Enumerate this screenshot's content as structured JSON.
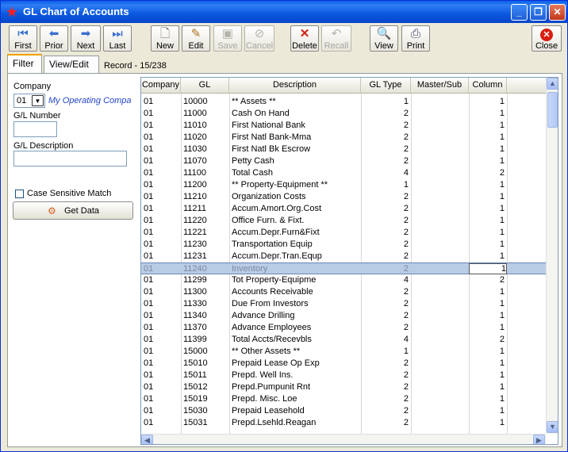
{
  "window": {
    "title": "GL Chart of Accounts"
  },
  "toolbar": {
    "first": "First",
    "prior": "Prior",
    "next": "Next",
    "last": "Last",
    "new": "New",
    "edit": "Edit",
    "save": "Save",
    "cancel": "Cancel",
    "delete": "Delete",
    "recall": "Recall",
    "view": "View",
    "print": "Print",
    "close": "Close"
  },
  "tabs": {
    "filter": "Filter",
    "view_edit": "View/Edit"
  },
  "record": "Record - 15/238",
  "filter": {
    "company_label": "Company",
    "company_value": "01",
    "company_name": "My Operating Compa",
    "gl_number_label": "G/L Number",
    "gl_number_value": "",
    "gl_desc_label": "G/L Description",
    "gl_desc_value": "",
    "case_sensitive_label": "Case Sensitive Match",
    "get_data_label": "Get Data"
  },
  "grid": {
    "columns": [
      "Company",
      "GL",
      "Description",
      "GL Type",
      "Master/Sub",
      "Column"
    ],
    "rows": [
      [
        "01",
        "10000",
        "** Assets **",
        "1",
        "",
        "1"
      ],
      [
        "01",
        "11000",
        "Cash On Hand",
        "2",
        "",
        "1"
      ],
      [
        "01",
        "11010",
        "First National Bank",
        "2",
        "",
        "1"
      ],
      [
        "01",
        "11020",
        "First Natl Bank-Mma",
        "2",
        "",
        "1"
      ],
      [
        "01",
        "11030",
        "First Natl Bk Escrow",
        "2",
        "",
        "1"
      ],
      [
        "01",
        "11070",
        "Petty Cash",
        "2",
        "",
        "1"
      ],
      [
        "01",
        "11100",
        "Total Cash",
        "4",
        "",
        "2"
      ],
      [
        "01",
        "11200",
        "** Property-Equipment **",
        "1",
        "",
        "1"
      ],
      [
        "01",
        "11210",
        "Organization Costs",
        "2",
        "",
        "1"
      ],
      [
        "01",
        "11211",
        "Accum.Amort.Org.Cost",
        "2",
        "",
        "1"
      ],
      [
        "01",
        "11220",
        "Office Furn. & Fixt.",
        "2",
        "",
        "1"
      ],
      [
        "01",
        "11221",
        "Accum.Depr.Furn&Fixt",
        "2",
        "",
        "1"
      ],
      [
        "01",
        "11230",
        "Transportation Equip",
        "2",
        "",
        "1"
      ],
      [
        "01",
        "11231",
        "Accum.Depr.Tran.Equp",
        "2",
        "",
        "1"
      ],
      [
        "01",
        "11240",
        "Inventory",
        "2",
        "",
        "1"
      ],
      [
        "01",
        "11299",
        "Tot Property-Equipme",
        "4",
        "",
        "2"
      ],
      [
        "01",
        "11300",
        "Accounts Receivable",
        "2",
        "",
        "1"
      ],
      [
        "01",
        "11330",
        "Due From Investors",
        "2",
        "",
        "1"
      ],
      [
        "01",
        "11340",
        "Advance Drilling",
        "2",
        "",
        "1"
      ],
      [
        "01",
        "11370",
        "Advance Employees",
        "2",
        "",
        "1"
      ],
      [
        "01",
        "11399",
        "Total Accts/Recevbls",
        "4",
        "",
        "2"
      ],
      [
        "01",
        "15000",
        "** Other Assets **",
        "1",
        "",
        "1"
      ],
      [
        "01",
        "15010",
        "Prepaid Lease Op Exp",
        "2",
        "",
        "1"
      ],
      [
        "01",
        "15011",
        "Prepd. Well Ins.",
        "2",
        "",
        "1"
      ],
      [
        "01",
        "15012",
        "Prepd.Pumpunit Rnt",
        "2",
        "",
        "1"
      ],
      [
        "01",
        "15019",
        "Prepd. Misc. Loe",
        "2",
        "",
        "1"
      ],
      [
        "01",
        "15030",
        "Prepaid Leasehold",
        "2",
        "",
        "1"
      ],
      [
        "01",
        "15031",
        "Prepd.Lsehld.Reagan",
        "2",
        "",
        "1"
      ]
    ],
    "selected_row": 14
  }
}
